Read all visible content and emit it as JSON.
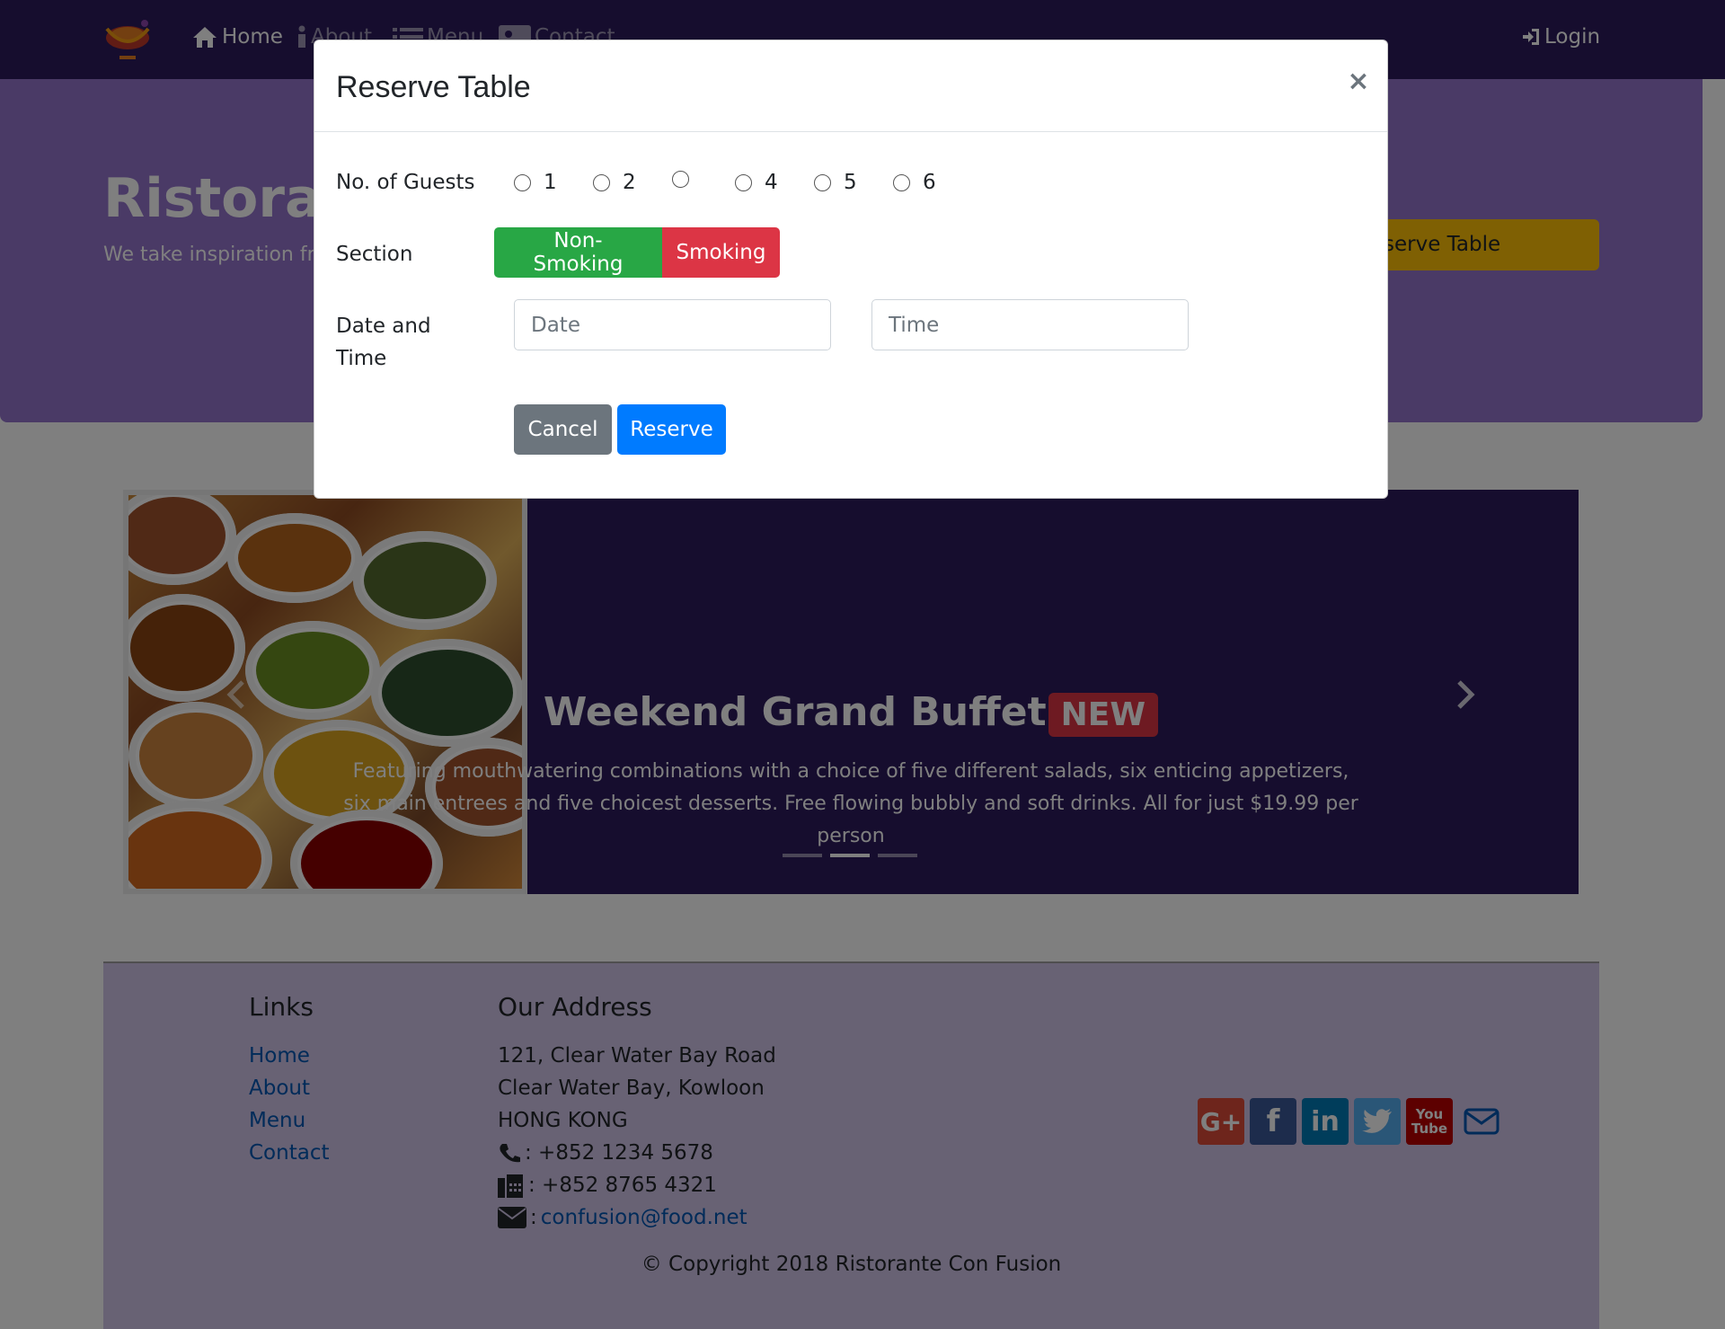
{
  "navbar": {
    "items": [
      {
        "label": "Home",
        "icon": "home-icon"
      },
      {
        "label": "About",
        "icon": "info-icon"
      },
      {
        "label": "Menu",
        "icon": "list-icon"
      },
      {
        "label": "Contact",
        "icon": "address-card-icon"
      }
    ],
    "login_label": "Login"
  },
  "jumbotron": {
    "title": "Ristorante",
    "text": "We take inspiration fro fusion experience. Our",
    "reserve_button": "serve Table"
  },
  "carousel": {
    "title": "Weekend Grand Buffet",
    "badge": "NEW",
    "text": "Featuring mouthwatering combinations with a choice of five different salads, six enticing appetizers, six main entrees and five choicest desserts. Free flowing bubbly and soft drinks. All for just $19.99 per person",
    "active_slide": 2,
    "slide_count": 3
  },
  "footer": {
    "links_title": "Links",
    "links": [
      "Home",
      "About",
      "Menu",
      "Contact"
    ],
    "address_title": "Our Address",
    "address_lines": [
      "121, Clear Water Bay Road",
      "Clear Water Bay, Kowloon",
      "HONG KONG"
    ],
    "phone": ": +852 1234 5678",
    "fax": ": +852 8765 4321",
    "email_prefix": ":",
    "email": "confusion@food.net",
    "copyright": "© Copyright 2018 Ristorante Con Fusion",
    "social": [
      "G+",
      "f",
      "in",
      "twitter",
      "YouTube",
      "mail"
    ]
  },
  "modal": {
    "title": "Reserve Table",
    "close": "×",
    "guests_label": "No. of Guests",
    "guest_options": [
      "1",
      "2",
      "",
      "4",
      "5",
      "6"
    ],
    "section_label": "Section",
    "non_smoking": "Non-Smoking",
    "smoking": "Smoking",
    "datetime_label": "Date and Time",
    "date_placeholder": "Date",
    "time_placeholder": "Time",
    "cancel": "Cancel",
    "reserve": "Reserve"
  },
  "colors": {
    "navbar": "#2c1a5c",
    "jumbotron": "#9575cd",
    "footer": "#d1c4e9",
    "reserve_button": "#ffc107",
    "non_smoking": "#28a745",
    "smoking": "#dc3545",
    "cancel": "#6c757d",
    "primary": "#007bff"
  }
}
